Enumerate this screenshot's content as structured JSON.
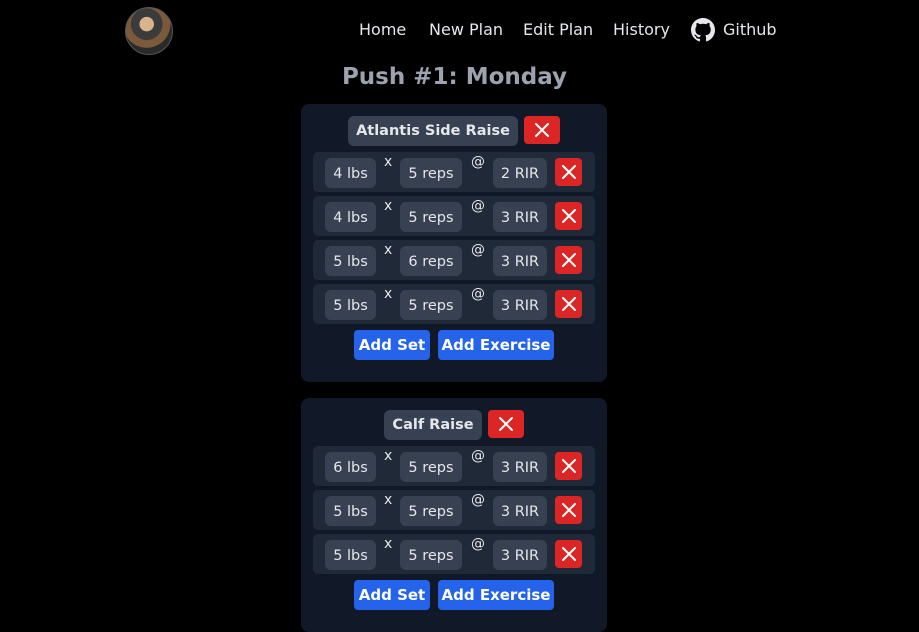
{
  "nav": {
    "links": [
      "Home",
      "New Plan",
      "Edit Plan",
      "History"
    ],
    "github_label": "Github"
  },
  "page_title": "Push #1: Monday",
  "colors": {
    "background": "#000000",
    "card": "#111827",
    "row": "#1f2937",
    "pill": "#374151",
    "delete": "#dc2626",
    "primary": "#2563eb"
  },
  "exercises": [
    {
      "name": "Atlantis Side Raise",
      "sets": [
        {
          "weight": "4 lbs",
          "reps": "5 reps",
          "rir": "2 RIR"
        },
        {
          "weight": "4 lbs",
          "reps": "5 reps",
          "rir": "3 RIR"
        },
        {
          "weight": "5 lbs",
          "reps": "6 reps",
          "rir": "3 RIR"
        },
        {
          "weight": "5 lbs",
          "reps": "5 reps",
          "rir": "3 RIR"
        }
      ],
      "add_set_label": "Add Set",
      "add_exercise_label": "Add Exercise"
    },
    {
      "name": "Calf Raise",
      "sets": [
        {
          "weight": "6 lbs",
          "reps": "5 reps",
          "rir": "3 RIR"
        },
        {
          "weight": "5 lbs",
          "reps": "5 reps",
          "rir": "3 RIR"
        },
        {
          "weight": "5 lbs",
          "reps": "5 reps",
          "rir": "3 RIR"
        }
      ],
      "add_set_label": "Add Set",
      "add_exercise_label": "Add Exercise"
    }
  ],
  "separators": {
    "times": "x",
    "at": "@"
  },
  "icons": {
    "delete": "close-icon",
    "github": "github-icon"
  }
}
